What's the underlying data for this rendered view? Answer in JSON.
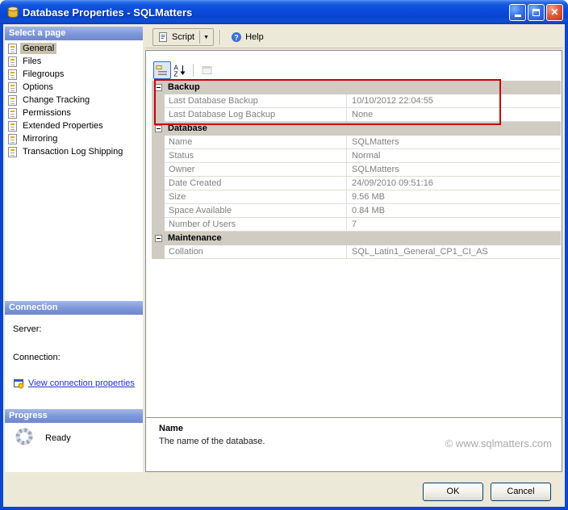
{
  "window": {
    "title": "Database Properties - SQLMatters"
  },
  "sidebar": {
    "select_page_header": "Select a page",
    "pages": [
      {
        "label": "General",
        "selected": true
      },
      {
        "label": "Files",
        "selected": false
      },
      {
        "label": "Filegroups",
        "selected": false
      },
      {
        "label": "Options",
        "selected": false
      },
      {
        "label": "Change Tracking",
        "selected": false
      },
      {
        "label": "Permissions",
        "selected": false
      },
      {
        "label": "Extended Properties",
        "selected": false
      },
      {
        "label": "Mirroring",
        "selected": false
      },
      {
        "label": "Transaction Log Shipping",
        "selected": false
      }
    ],
    "connection_header": "Connection",
    "server_label": "Server:",
    "connection_label": "Connection:",
    "view_connection_link": "View connection properties",
    "progress_header": "Progress",
    "progress_status": "Ready"
  },
  "toolbar": {
    "script_label": "Script",
    "help_label": "Help"
  },
  "property_grid": {
    "categories": [
      {
        "name": "Backup",
        "properties": [
          {
            "name": "Last Database Backup",
            "value": "10/10/2012 22:04:55"
          },
          {
            "name": "Last Database Log Backup",
            "value": "None"
          }
        ]
      },
      {
        "name": "Database",
        "properties": [
          {
            "name": "Name",
            "value": "SQLMatters"
          },
          {
            "name": "Status",
            "value": "Normal"
          },
          {
            "name": "Owner",
            "value": "SQLMatters"
          },
          {
            "name": "Date Created",
            "value": "24/09/2010 09:51:16"
          },
          {
            "name": "Size",
            "value": "9.56 MB"
          },
          {
            "name": "Space Available",
            "value": "0.84 MB"
          },
          {
            "name": "Number of Users",
            "value": "7"
          }
        ]
      },
      {
        "name": "Maintenance",
        "properties": [
          {
            "name": "Collation",
            "value": "SQL_Latin1_General_CP1_CI_AS"
          }
        ]
      }
    ]
  },
  "description": {
    "title": "Name",
    "text": "The name of the database.",
    "watermark": "© www.sqlmatters.com"
  },
  "buttons": {
    "ok": "OK",
    "cancel": "Cancel"
  },
  "annotation": {
    "color": "#CE0000"
  }
}
